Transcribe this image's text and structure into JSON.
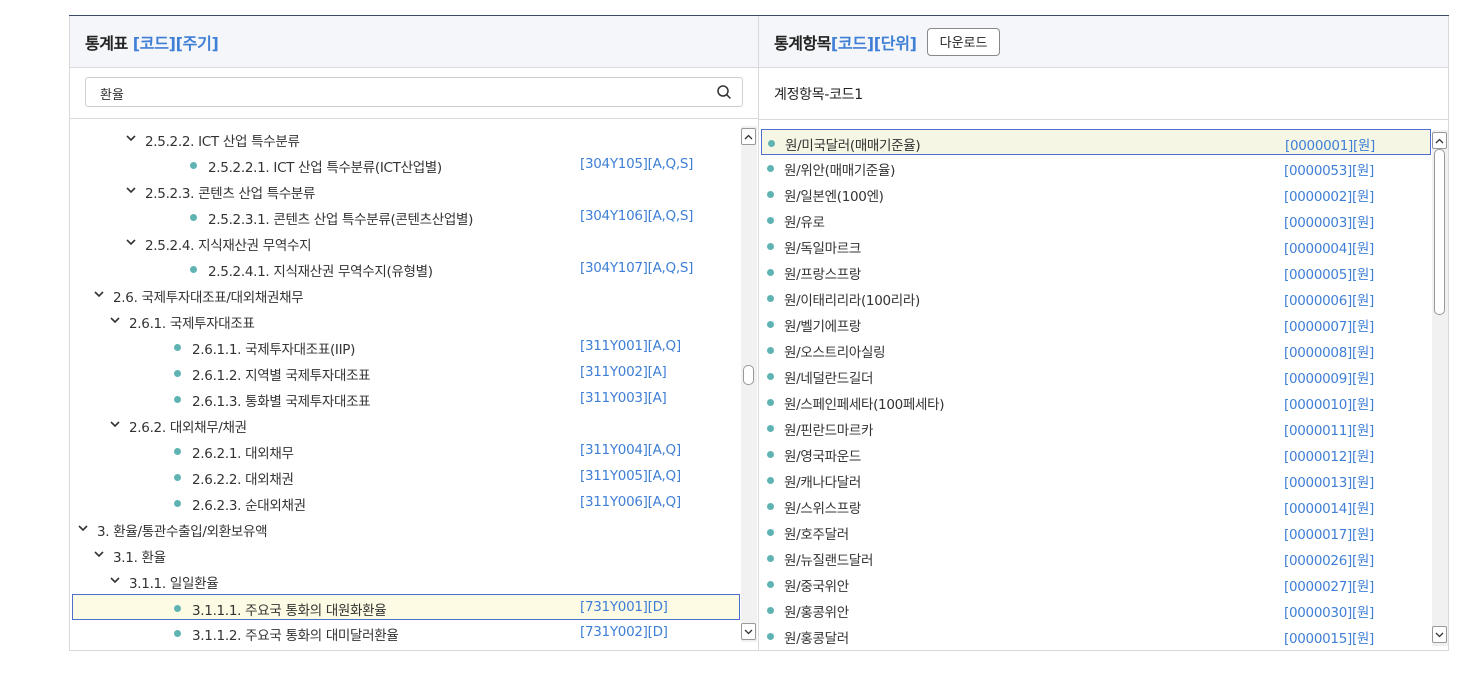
{
  "left_panel": {
    "title": "통계표",
    "title_suffix": "[코드][주기]",
    "search_value": "환율",
    "tree": [
      {
        "label": "2.5.2.2. ICT 산업 특수분류",
        "code": "",
        "expanded": true
      },
      {
        "label": "2.5.2.2.1. ICT 산업 특수분류(ICT산업별)",
        "code": "[304Y105][A,Q,S]"
      },
      {
        "label": "2.5.2.3. 콘텐츠 산업 특수분류",
        "code": "",
        "expanded": true
      },
      {
        "label": "2.5.2.3.1. 콘텐츠 산업 특수분류(콘텐츠산업별)",
        "code": "[304Y106][A,Q,S]"
      },
      {
        "label": "2.5.2.4. 지식재산권 무역수지",
        "code": "",
        "expanded": true
      },
      {
        "label": "2.5.2.4.1. 지식재산권 무역수지(유형별)",
        "code": "[304Y107][A,Q,S]"
      },
      {
        "label": "2.6. 국제투자대조표/대외채권채무",
        "code": "",
        "expanded": true
      },
      {
        "label": "2.6.1. 국제투자대조표",
        "code": "",
        "expanded": true
      },
      {
        "label": "2.6.1.1. 국제투자대조표(IIP)",
        "code": "[311Y001][A,Q]"
      },
      {
        "label": "2.6.1.2. 지역별 국제투자대조표",
        "code": "[311Y002][A]"
      },
      {
        "label": "2.6.1.3. 통화별 국제투자대조표",
        "code": "[311Y003][A]"
      },
      {
        "label": "2.6.2. 대외채무/채권",
        "code": "",
        "expanded": true
      },
      {
        "label": "2.6.2.1. 대외채무",
        "code": "[311Y004][A,Q]"
      },
      {
        "label": "2.6.2.2. 대외채권",
        "code": "[311Y005][A,Q]"
      },
      {
        "label": "2.6.2.3. 순대외채권",
        "code": "[311Y006][A,Q]"
      },
      {
        "label": "3. 환율/통관수출입/외환보유액",
        "code": "",
        "expanded": true
      },
      {
        "label": "3.1. 환율",
        "code": "",
        "expanded": true
      },
      {
        "label": "3.1.1. 일일환율",
        "code": "",
        "expanded": true
      },
      {
        "label": "3.1.1.1. 주요국 통화의 대원화환율",
        "code": "[731Y001][D]",
        "selected": true
      },
      {
        "label": "3.1.1.2. 주요국 통화의 대미달러환율",
        "code": "[731Y002][D]"
      }
    ],
    "scroll_position": 0.48
  },
  "right_panel": {
    "title": "통계항목",
    "title_suffix": "[코드][단위]",
    "download_label": "다운로드",
    "subheader": "계정항목-코드1",
    "items": [
      {
        "label": "원/미국달러(매매기준율)",
        "code": "[0000001][원]",
        "selected": true
      },
      {
        "label": "원/위안(매매기준율)",
        "code": "[0000053][원]"
      },
      {
        "label": "원/일본엔(100엔)",
        "code": "[0000002][원]"
      },
      {
        "label": "원/유로",
        "code": "[0000003][원]"
      },
      {
        "label": "원/독일마르크",
        "code": "[0000004][원]"
      },
      {
        "label": "원/프랑스프랑",
        "code": "[0000005][원]"
      },
      {
        "label": "원/이태리리라(100리라)",
        "code": "[0000006][원]"
      },
      {
        "label": "원/벨기에프랑",
        "code": "[0000007][원]"
      },
      {
        "label": "원/오스트리아실링",
        "code": "[0000008][원]"
      },
      {
        "label": "원/네덜란드길더",
        "code": "[0000009][원]"
      },
      {
        "label": "원/스페인페세타(100페세타)",
        "code": "[0000010][원]"
      },
      {
        "label": "원/핀란드마르카",
        "code": "[0000011][원]"
      },
      {
        "label": "원/영국파운드",
        "code": "[0000012][원]"
      },
      {
        "label": "원/캐나다달러",
        "code": "[0000013][원]"
      },
      {
        "label": "원/스위스프랑",
        "code": "[0000014][원]"
      },
      {
        "label": "원/호주달러",
        "code": "[0000017][원]"
      },
      {
        "label": "원/뉴질랜드달러",
        "code": "[0000026][원]"
      },
      {
        "label": "원/중국위안",
        "code": "[0000027][원]"
      },
      {
        "label": "원/홍콩위안",
        "code": "[0000030][원]"
      },
      {
        "label": "원/홍콩달러",
        "code": "[0000015][원]"
      }
    ],
    "scroll_position": 0
  },
  "colors": {
    "accent": "#3f7fd6",
    "dot": "#5fb3b3",
    "selected_border": "#4f6fcf"
  }
}
